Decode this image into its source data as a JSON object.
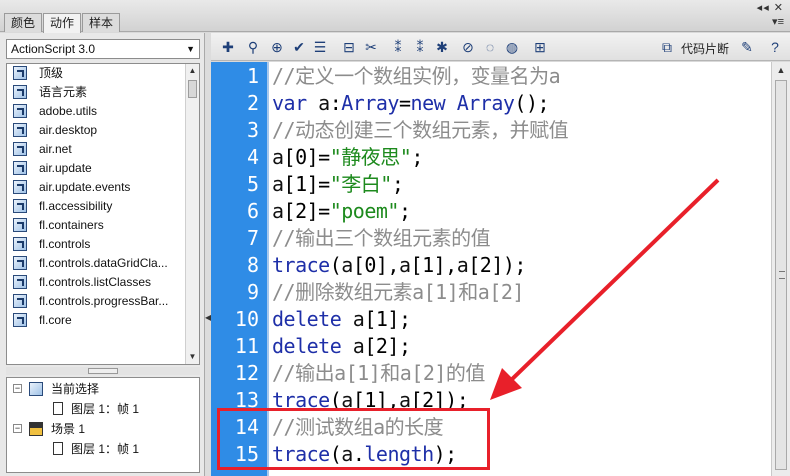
{
  "tabs": [
    {
      "label": "颜色"
    },
    {
      "label": "动作"
    },
    {
      "label": "样本"
    }
  ],
  "window_controls": "◂◂ ✕",
  "panel_menu": "▾≡",
  "language_select": {
    "value": "ActionScript 3.0"
  },
  "packages": [
    {
      "label": "顶级"
    },
    {
      "label": "语言元素"
    },
    {
      "label": "adobe.utils"
    },
    {
      "label": "air.desktop"
    },
    {
      "label": "air.net"
    },
    {
      "label": "air.update"
    },
    {
      "label": "air.update.events"
    },
    {
      "label": "fl.accessibility"
    },
    {
      "label": "fl.containers"
    },
    {
      "label": "fl.controls"
    },
    {
      "label": "fl.controls.dataGridCla..."
    },
    {
      "label": "fl.controls.listClasses"
    },
    {
      "label": "fl.controls.progressBar..."
    },
    {
      "label": "fl.core"
    }
  ],
  "tree": {
    "current_selection": "当前选择",
    "current_layer": "图层 1：帧 1",
    "scene": "场景 1",
    "scene_layer": "图层 1：帧 1"
  },
  "toolbar": {
    "code_snippets_label": "代码片断"
  },
  "code_lines": [
    {
      "num": "1",
      "text": "//定义一个数组实例，变量名为a"
    },
    {
      "num": "2",
      "text": "var a:Array=new Array();"
    },
    {
      "num": "3",
      "text": "//动态创建三个数组元素，并赋值"
    },
    {
      "num": "4",
      "text": "a[0]=\"静夜思\";"
    },
    {
      "num": "5",
      "text": "a[1]=\"李白\";"
    },
    {
      "num": "6",
      "text": "a[2]=\"poem\";"
    },
    {
      "num": "7",
      "text": "//输出三个数组元素的值"
    },
    {
      "num": "8",
      "text": "trace(a[0],a[1],a[2]);"
    },
    {
      "num": "9",
      "text": "//删除数组元素a[1]和a[2]"
    },
    {
      "num": "10",
      "text": "delete a[1];"
    },
    {
      "num": "11",
      "text": "delete a[2];"
    },
    {
      "num": "12",
      "text": "//输出a[1]和a[2]的值"
    },
    {
      "num": "13",
      "text": "trace(a[1],a[2]);"
    },
    {
      "num": "14",
      "text": "//测试数组a的长度"
    },
    {
      "num": "15",
      "text": "trace(a.length);"
    }
  ],
  "colors": {
    "gutter": "#2f8ce6",
    "keyword": "#1e2fa8",
    "string": "#1d8a1d",
    "comment": "#8c8c8c",
    "annotation": "#e8202a"
  }
}
